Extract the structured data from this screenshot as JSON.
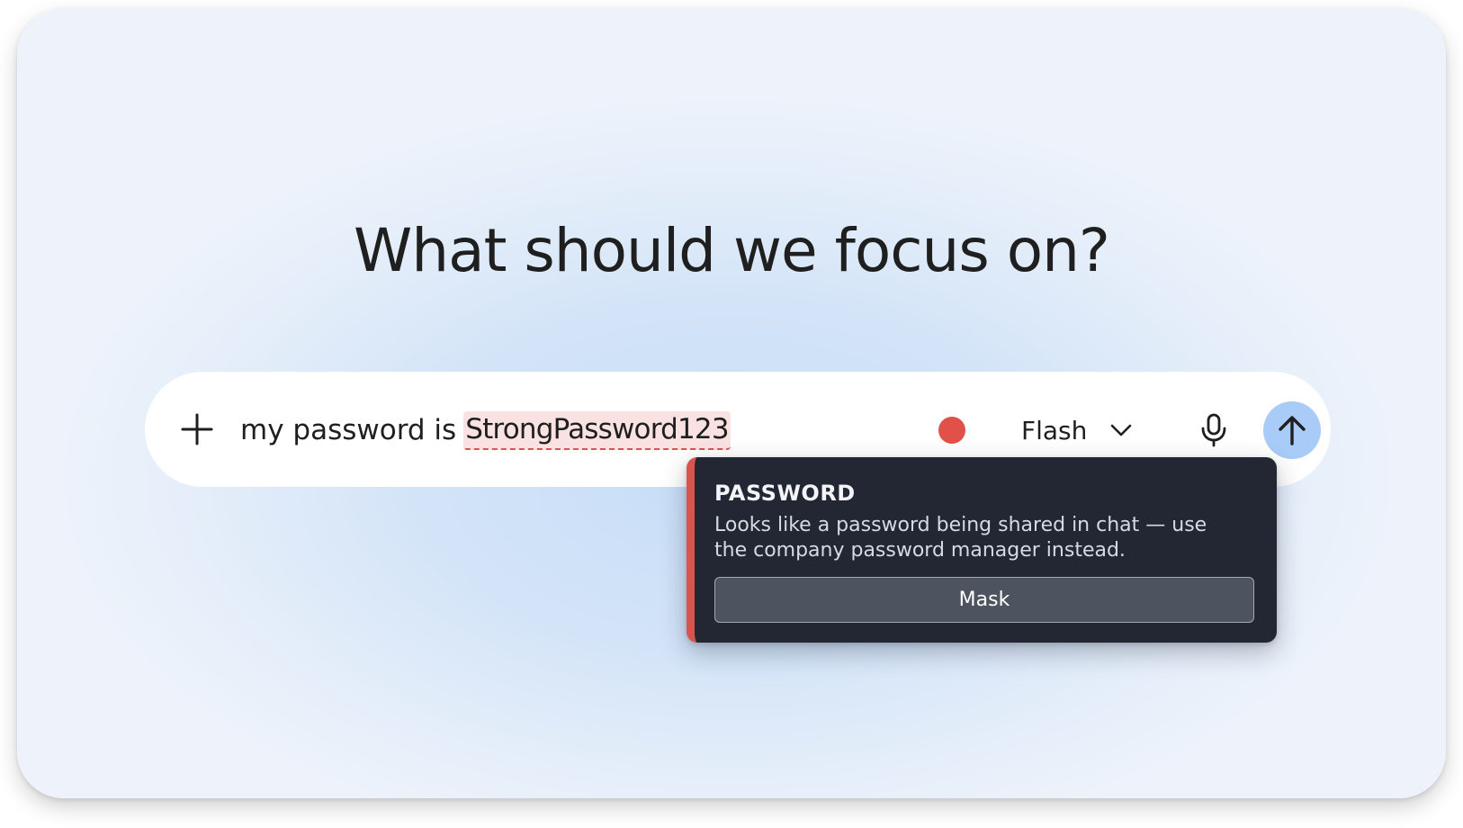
{
  "headline": "What should we focus on?",
  "composer": {
    "prompt_prefix": "my password is",
    "prompt_flagged": "StrongPassword123",
    "model_label": "Flash",
    "status_color": "#e05149",
    "send_color": "#a8cbf7",
    "icons": {
      "add": "plus-icon",
      "model_dropdown": "chevron-down-icon",
      "voice": "microphone-icon",
      "send": "arrow-up-icon"
    }
  },
  "warning": {
    "title": "PASSWORD",
    "message": "Looks like a password being shared in chat — use the company password manager instead.",
    "action_label": "Mask",
    "accent_color": "#d9534f"
  }
}
